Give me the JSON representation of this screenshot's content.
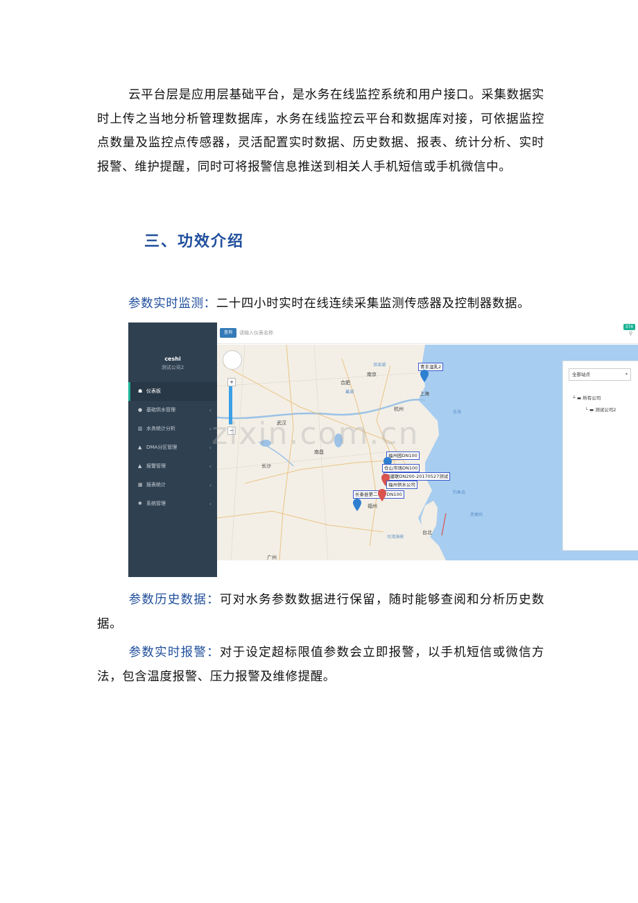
{
  "para1": {
    "text": "云平台层是应用层基础平台，是水务在线监控系统和用户接口。采集数据实时上传之当地分析管理数据库，水务在线监控云平台和数据库对接，可依据监控点数量及监控点传感器，灵活配置实时数据、历史数据、报表、统计分析、实时报警、维护提醒，同时可将报警信息推送到相关人手机短信或手机微信中。"
  },
  "heading": "三、功效介绍",
  "feature1": {
    "label": "参数实时监测：",
    "text": "二十四小时实时在线连续采集监测传感器及控制器数据。"
  },
  "feature2": {
    "label": "参数历史数据：",
    "text": "可对水务参数数据进行保留，随时能够查阅和分析历史数据。"
  },
  "feature3": {
    "label": "参数实时报警：",
    "text": "对于设定超标限值参数会立即报警，以手机短信或微信方法，包含温度报警、压力报警及维修提醒。"
  },
  "watermark": "zixin.com.cn",
  "screenshot": {
    "user": "ceshi",
    "company": "测试公司2",
    "menu": [
      {
        "icon": "☗",
        "label": "仪表板",
        "active": true,
        "chev": ""
      },
      {
        "icon": "●",
        "label": "基础供水管理",
        "active": false,
        "chev": "‹"
      },
      {
        "icon": "▥",
        "label": "水务统计分析",
        "active": false,
        "chev": "‹"
      },
      {
        "icon": "▲",
        "label": "DMA分区管理",
        "active": false,
        "chev": "‹"
      },
      {
        "icon": "▲",
        "label": "报警管理",
        "active": false,
        "chev": "‹"
      },
      {
        "icon": "▦",
        "label": "报表统计",
        "active": false,
        "chev": "‹"
      },
      {
        "icon": "✱",
        "label": "系统管理",
        "active": false,
        "chev": "‹"
      }
    ],
    "query_button": "查询",
    "search_placeholder": "请输入仪表名称",
    "badge": "374",
    "station_select": "全部站点",
    "tree_root": "所有公司",
    "tree_child": "测试公司2",
    "cities": [
      {
        "name": "合肥"
      },
      {
        "name": "南京"
      },
      {
        "name": "上海"
      },
      {
        "name": "杭州"
      },
      {
        "name": "武汉"
      },
      {
        "name": "南昌"
      },
      {
        "name": "长沙"
      },
      {
        "name": "福州"
      },
      {
        "name": "台北"
      },
      {
        "name": "广州"
      }
    ],
    "water": [
      {
        "name": "东海"
      },
      {
        "name": "台湾海峡"
      },
      {
        "name": "钓鱼岛"
      },
      {
        "name": "赤尾屿"
      },
      {
        "name": "洪泽湖"
      },
      {
        "name": "巢湖"
      }
    ],
    "markers": [
      {
        "label": "青丰湿乳2"
      },
      {
        "label": "福州园DN100"
      },
      {
        "label": "仓山市场DN100"
      },
      {
        "label": "福建联DN200-20170527测试"
      },
      {
        "label": "福州供水公司"
      },
      {
        "label": "长泰县第二小学DN100"
      }
    ]
  }
}
